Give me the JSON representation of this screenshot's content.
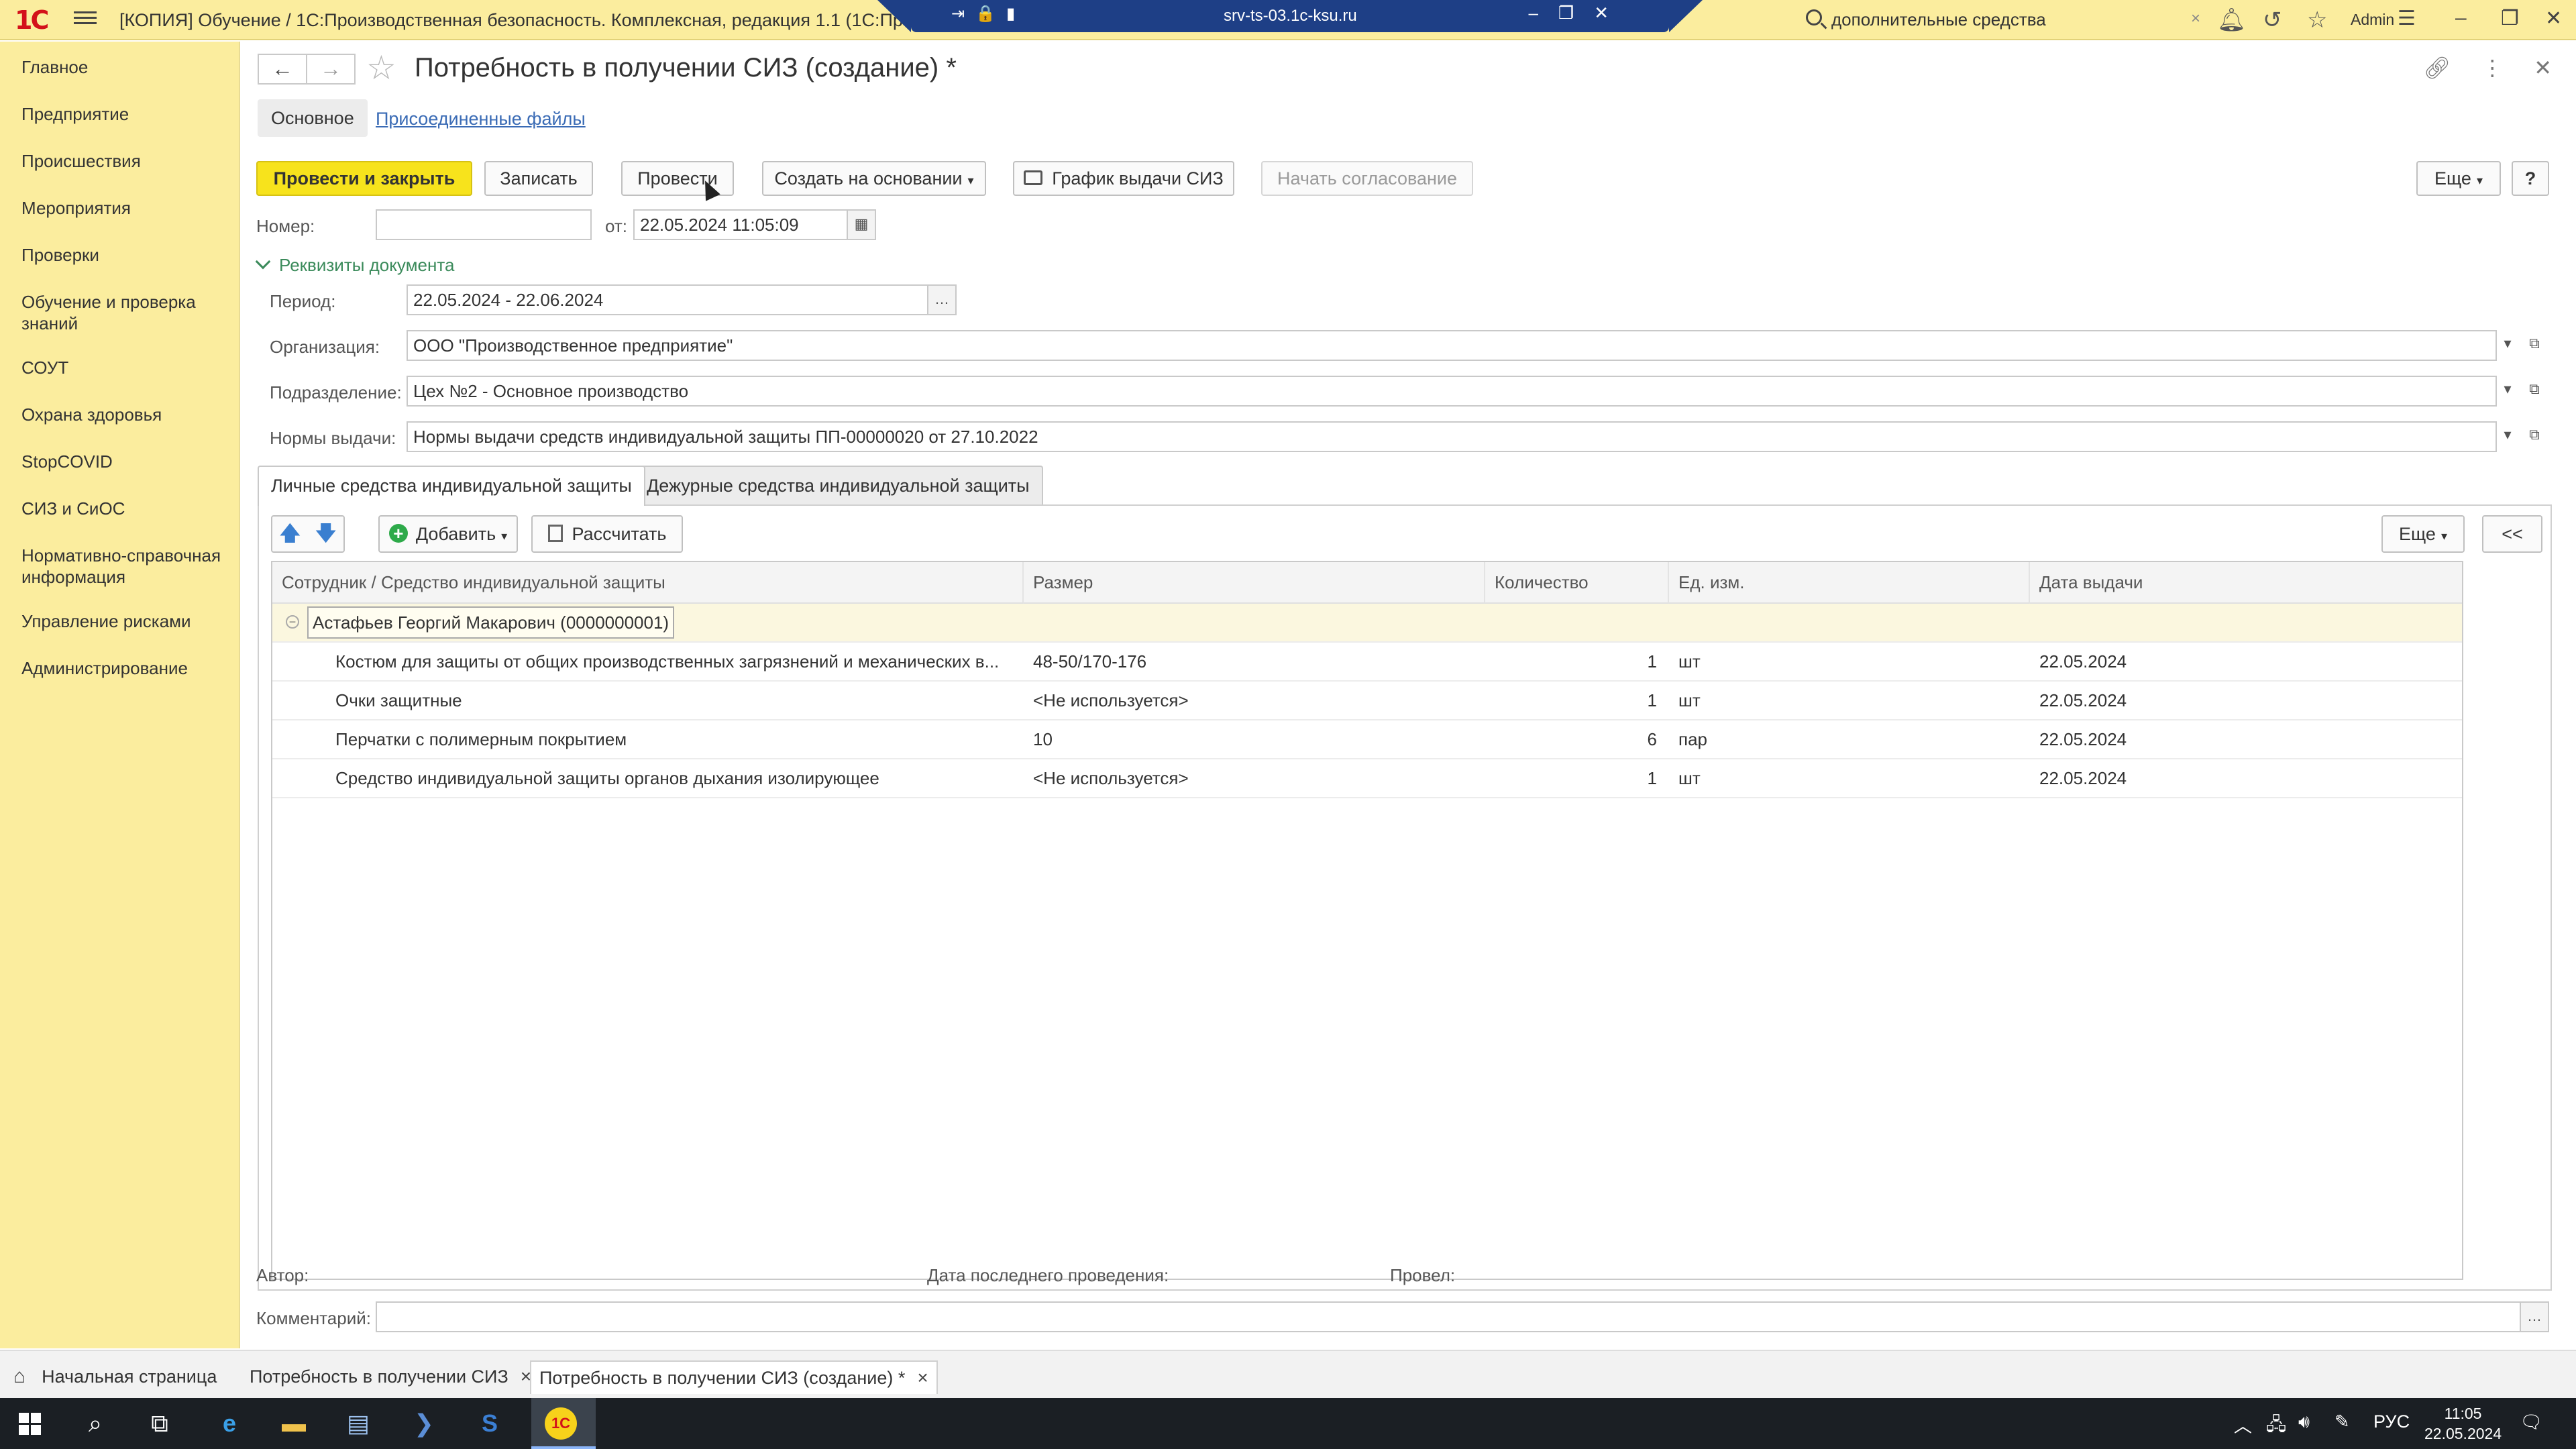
{
  "window": {
    "title": "[КОПИЯ] Обучение / 1С:Производственная безопасность. Комплексная, редакция 1.1 (1С:Предпр",
    "rdp_host": "srv-ts-03.1c-ksu.ru",
    "search_value": "дополнительные средства",
    "user": "Admin"
  },
  "sidebar": {
    "items": [
      {
        "label": "Главное"
      },
      {
        "label": "Предприятие"
      },
      {
        "label": "Происшествия"
      },
      {
        "label": "Мероприятия"
      },
      {
        "label": "Проверки"
      },
      {
        "label": "Обучение и проверка знаний"
      },
      {
        "label": "СОУТ"
      },
      {
        "label": "Охрана здоровья"
      },
      {
        "label": "StopCOVID"
      },
      {
        "label": "СИЗ и СиОС"
      },
      {
        "label": "Нормативно-справочная информация"
      },
      {
        "label": "Управление рисками"
      },
      {
        "label": "Администрирование"
      }
    ]
  },
  "form": {
    "title": "Потребность в получении СИЗ (создание) *",
    "tabs": {
      "main": "Основное",
      "files": "Присоединенные файлы"
    },
    "toolbar": {
      "post_close": "Провести и закрыть",
      "save": "Записать",
      "post": "Провести",
      "create_based": "Создать на основании",
      "schedule": "График выдачи СИЗ",
      "approval": "Начать согласование",
      "more": "Еще",
      "help": "?"
    },
    "number_label": "Номер:",
    "number_value": "",
    "date_label": "от:",
    "date_value": "22.05.2024 11:05:09",
    "group_header": "Реквизиты документа",
    "period_label": "Период:",
    "period_value": "22.05.2024 - 22.06.2024",
    "org_label": "Организация:",
    "org_value": "ООО \"Производственное предприятие\"",
    "dept_label": "Подразделение:",
    "dept_value": "Цех №2 - Основное производство",
    "norms_label": "Нормы выдачи:",
    "norms_value": "Нормы выдачи средств индивидуальной защиты ПП-00000020 от 27.10.2022",
    "ppe_tabs": {
      "personal": "Личные средства индивидуальной защиты",
      "duty": "Дежурные средства индивидуальной защиты"
    },
    "table_toolbar": {
      "add": "Добавить",
      "calculate": "Рассчитать",
      "more": "Еще",
      "collapse": "<<"
    },
    "table": {
      "columns": [
        "Сотрудник / Средство индивидуальной защиты",
        "Размер",
        "Количество",
        "Ед. изм.",
        "Дата выдачи"
      ],
      "group": "Астафьев Георгий Макарович (0000000001)",
      "rows": [
        {
          "name": "Костюм для защиты от общих производственных загрязнений и механических в...",
          "size": "48-50/170-176",
          "qty": "1",
          "unit": "шт",
          "date": "22.05.2024"
        },
        {
          "name": "Очки защитные",
          "size": "<Не используется>",
          "qty": "1",
          "unit": "шт",
          "date": "22.05.2024"
        },
        {
          "name": "Перчатки с полимерным покрытием",
          "size": "10",
          "qty": "6",
          "unit": "пар",
          "date": "22.05.2024"
        },
        {
          "name": "Средство индивидуальной защиты органов дыхания изолирующее",
          "size": "<Не используется>",
          "qty": "1",
          "unit": "шт",
          "date": "22.05.2024"
        }
      ]
    },
    "footer": {
      "author_label": "Автор:",
      "last_post_label": "Дата последнего проведения:",
      "posted_by_label": "Провел:",
      "comment_label": "Комментарий:"
    }
  },
  "bottom_tabs": [
    {
      "label": "Начальная страница"
    },
    {
      "label": "Потребность в получении СИЗ"
    },
    {
      "label": "Потребность в получении СИЗ (создание) *"
    }
  ],
  "taskbar": {
    "lang": "РУС",
    "time": "11:05",
    "date": "22.05.2024"
  },
  "colors": {
    "panel_yellow": "#fbed9e",
    "primary_button": "#f7e31c",
    "link_blue": "#3a6bb5",
    "group_green": "#3a8a5a"
  }
}
